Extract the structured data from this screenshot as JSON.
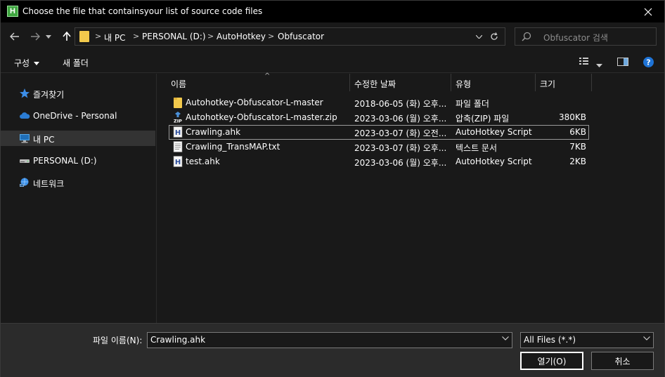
{
  "window": {
    "title": "Choose the file that containsyour list of source code files",
    "app_icon_letter": "H"
  },
  "nav": {
    "breadcrumbs": [
      "내 PC",
      "PERSONAL (D:)",
      "AutoHotkey",
      "Obfuscator"
    ],
    "search_placeholder": "Obfuscator 검색"
  },
  "toolbar": {
    "organize_label": "구성",
    "new_folder_label": "새 폴더"
  },
  "sidebar": {
    "items": [
      {
        "label": "즐겨찾기",
        "icon": "star-icon"
      },
      {
        "label": "OneDrive - Personal",
        "icon": "cloud-icon"
      },
      {
        "label": "내 PC",
        "icon": "computer-icon",
        "selected": true
      },
      {
        "label": "PERSONAL (D:)",
        "icon": "drive-icon"
      },
      {
        "label": "네트워크",
        "icon": "network-icon"
      }
    ]
  },
  "filelist": {
    "columns": [
      "이름",
      "수정한 날짜",
      "유형",
      "크기"
    ],
    "rows": [
      {
        "name": "Autohotkey-Obfuscator-L-master",
        "date": "2018-06-05 (화) 오후...",
        "type": "파일 폴더",
        "size": "",
        "icon": "folder-icon"
      },
      {
        "name": "Autohotkey-Obfuscator-L-master.zip",
        "date": "2023-03-06 (월) 오후...",
        "type": "압축(ZIP) 파일",
        "size": "380KB",
        "icon": "zip-icon"
      },
      {
        "name": "Crawling.ahk",
        "date": "2023-03-07 (화) 오전...",
        "type": "AutoHotkey Script",
        "size": "6KB",
        "icon": "ahk-icon",
        "focused": true
      },
      {
        "name": "Crawling_TransMAP.txt",
        "date": "2023-03-07 (화) 오후...",
        "type": "텍스트 문서",
        "size": "7KB",
        "icon": "text-file-icon"
      },
      {
        "name": "test.ahk",
        "date": "2023-03-06 (월) 오후...",
        "type": "AutoHotkey Script",
        "size": "2KB",
        "icon": "ahk-icon"
      }
    ]
  },
  "bottom": {
    "filename_label": "파일 이름(N):",
    "filename_value": "Crawling.ahk",
    "filter_value": "All Files (*.*)",
    "open_label": "열기(O)",
    "cancel_label": "취소"
  },
  "colors": {
    "background": "#191919",
    "titlebar": "#000000",
    "bottom_panel": "#2b2b2b",
    "folder": "#f2c94c",
    "help": "#1e73d6"
  }
}
